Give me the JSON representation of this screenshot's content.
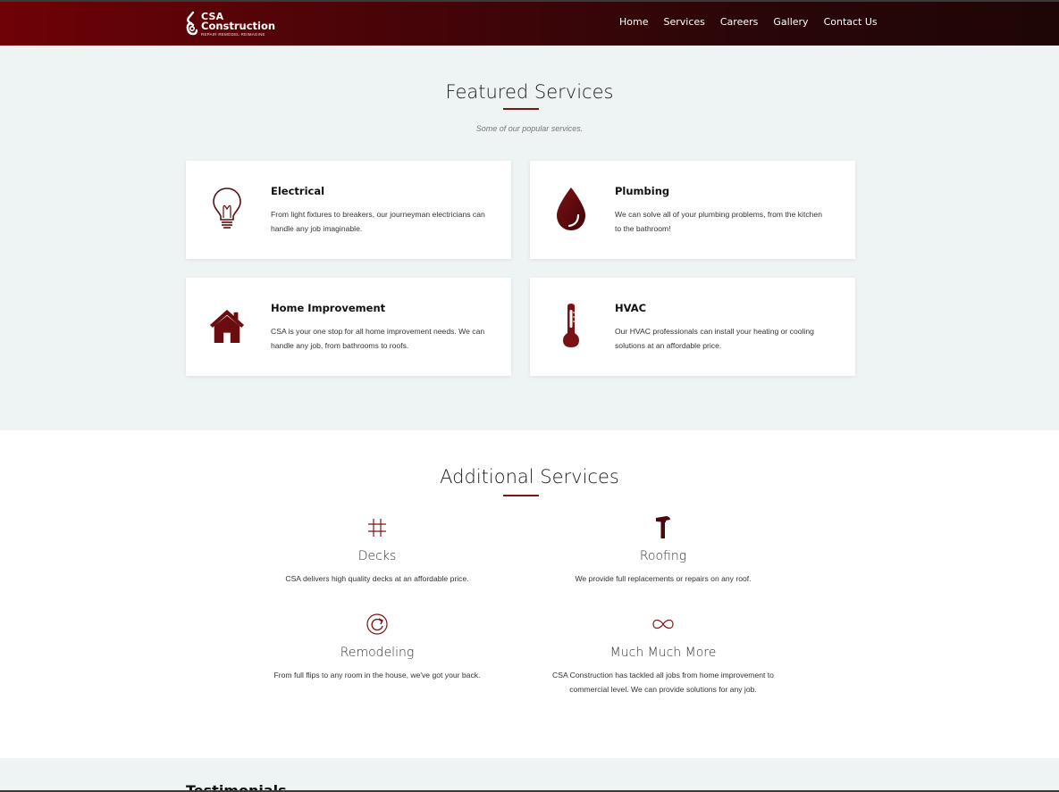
{
  "brand": {
    "name_line1": "CSA",
    "name_line2": "Construction",
    "tagline": "REPAIR·REMODEL·REIMAGINE",
    "logo_icon": "chain-link-icon"
  },
  "nav": {
    "items": [
      {
        "label": "Home"
      },
      {
        "label": "Services"
      },
      {
        "label": "Careers"
      },
      {
        "label": "Gallery"
      },
      {
        "label": "Contact Us"
      }
    ]
  },
  "featured": {
    "title": "Featured Services",
    "subtitle": "Some of our popular services.",
    "cards": [
      {
        "icon": "lightbulb-icon",
        "title": "Electrical",
        "text": "From light fixtures to breakers, our journeyman electricians can handle any job imaginable."
      },
      {
        "icon": "water-drop-icon",
        "title": "Plumbing",
        "text": "We can solve all of your plumbing problems, from the kitchen to the bathroom!"
      },
      {
        "icon": "house-icon",
        "title": "Home Improvement",
        "text": "CSA is your one stop for all home improvement needs. We can handle any job, from bathrooms to roofs."
      },
      {
        "icon": "thermometer-icon",
        "title": "HVAC",
        "text": "Our HVAC professionals can install your heating or cooling solutions at an affordable price."
      }
    ]
  },
  "additional": {
    "title": "Additional Services",
    "items": [
      {
        "icon": "grid-hash-icon",
        "title": "Decks",
        "text": "CSA delivers high quality decks at an affordable price."
      },
      {
        "icon": "hammer-icon",
        "title": "Roofing",
        "text": "We provide full replacements or repairs on any roof."
      },
      {
        "icon": "refresh-icon",
        "title": "Remodeling",
        "text": "From full flips to any room in the house, we've got your back."
      },
      {
        "icon": "infinity-icon",
        "title": "Much Much More",
        "text": "CSA Construction has tackled all jobs from home improvement to commercial level. We can provide solutions for any job."
      }
    ]
  },
  "testimonials": {
    "title": "Testimonials"
  },
  "colors": {
    "brand_dark_red": "#6e0207",
    "accent": "#7a1618",
    "section_bg": "#eef3f3"
  }
}
